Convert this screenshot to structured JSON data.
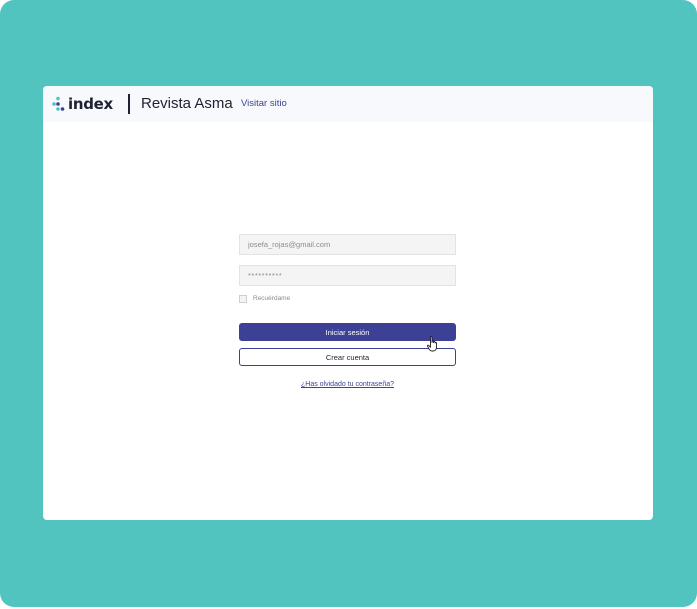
{
  "header": {
    "logo_text": "index",
    "journal_title": "Revista Asma",
    "visit_link": "Visitar sitio"
  },
  "login": {
    "email_value": "josefa_rojas@gmail.com",
    "password_value": "**********",
    "remember_label": "Recuérdame",
    "remember_checked": false,
    "login_button": "Iniciar sesión",
    "create_account_button": "Crear cuenta",
    "forgot_password_link": "¿Has olvidado tu contraseña?"
  },
  "colors": {
    "background": "#52c4c0",
    "primary": "#3c4196",
    "text": "#1d2233",
    "logo_dot_teal": "#4fc3c4",
    "logo_dot_blue": "#3c4196"
  },
  "icons": [
    "index-logo-icon",
    "hand-pointer-cursor-icon"
  ]
}
